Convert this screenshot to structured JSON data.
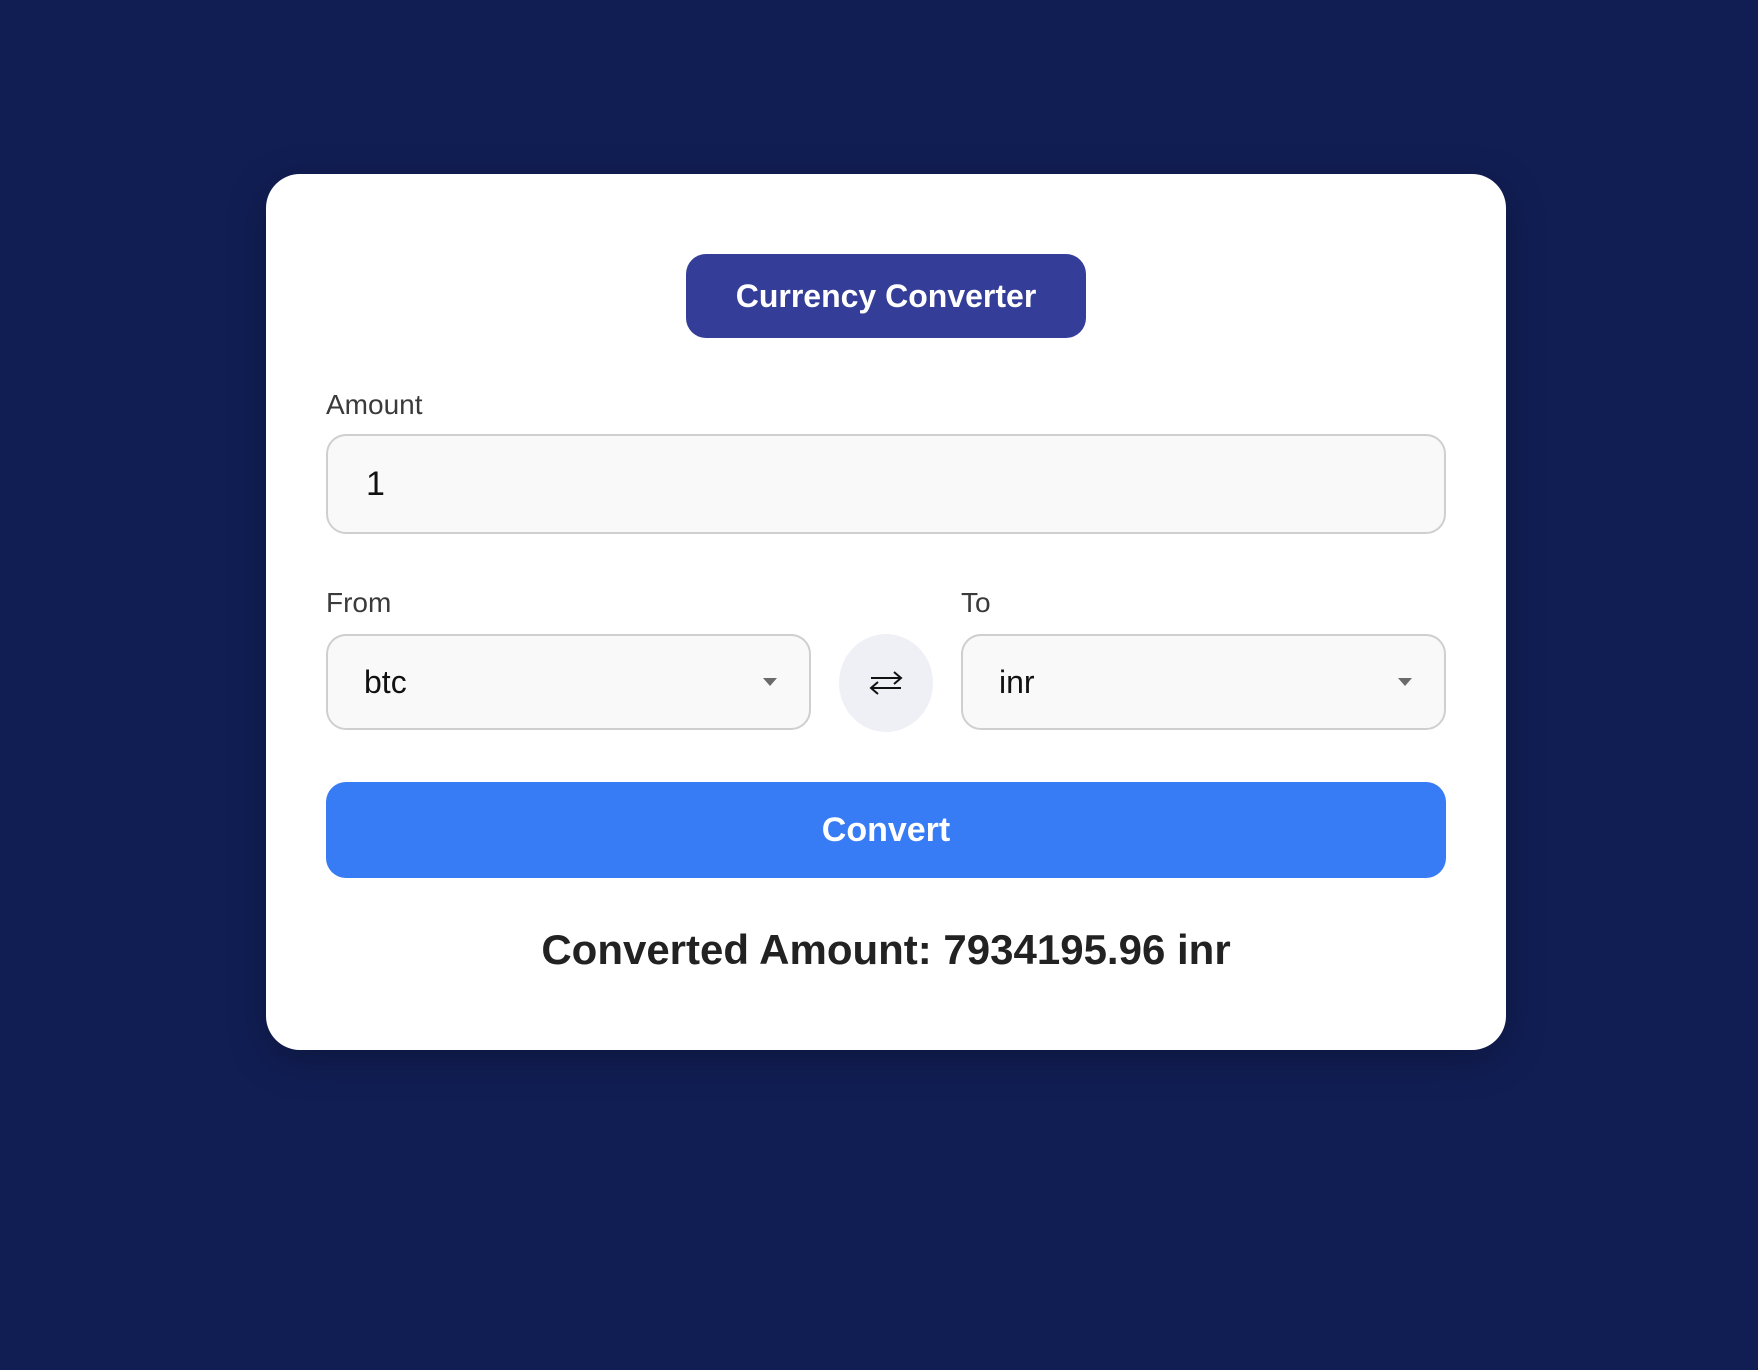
{
  "header": {
    "title": "Currency Converter"
  },
  "amount": {
    "label": "Amount",
    "value": "1"
  },
  "from": {
    "label": "From",
    "selected": "btc"
  },
  "to": {
    "label": "To",
    "selected": "inr"
  },
  "swap": {
    "icon": "swap-arrows-icon"
  },
  "convert_button": {
    "label": "Convert"
  },
  "result": {
    "text": "Converted Amount: 7934195.96 inr"
  },
  "colors": {
    "background": "#111e54",
    "title_badge": "#343d97",
    "convert_button": "#377bf5"
  }
}
